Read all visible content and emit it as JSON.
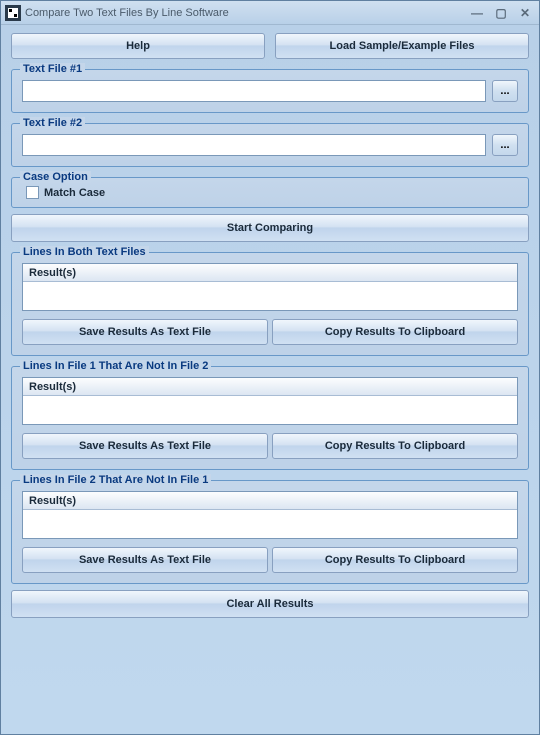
{
  "title": "Compare Two Text Files By Line Software",
  "toolbar": {
    "help": "Help",
    "load_sample": "Load Sample/Example Files"
  },
  "file1": {
    "legend": "Text File #1",
    "value": "",
    "browse": "..."
  },
  "file2": {
    "legend": "Text File #2",
    "value": "",
    "browse": "..."
  },
  "case_option": {
    "legend": "Case Option",
    "match_case": "Match Case"
  },
  "start": "Start Comparing",
  "group_both": {
    "legend": "Lines In Both Text Files",
    "results_header": "Result(s)",
    "save": "Save Results As Text File",
    "copy": "Copy Results To Clipboard"
  },
  "group_only1": {
    "legend": "Lines In File 1 That Are Not In File 2",
    "results_header": "Result(s)",
    "save": "Save Results As Text File",
    "copy": "Copy Results To Clipboard"
  },
  "group_only2": {
    "legend": "Lines In File 2 That Are Not In File 1",
    "results_header": "Result(s)",
    "save": "Save Results As Text File",
    "copy": "Copy Results To Clipboard"
  },
  "clear": "Clear All Results"
}
